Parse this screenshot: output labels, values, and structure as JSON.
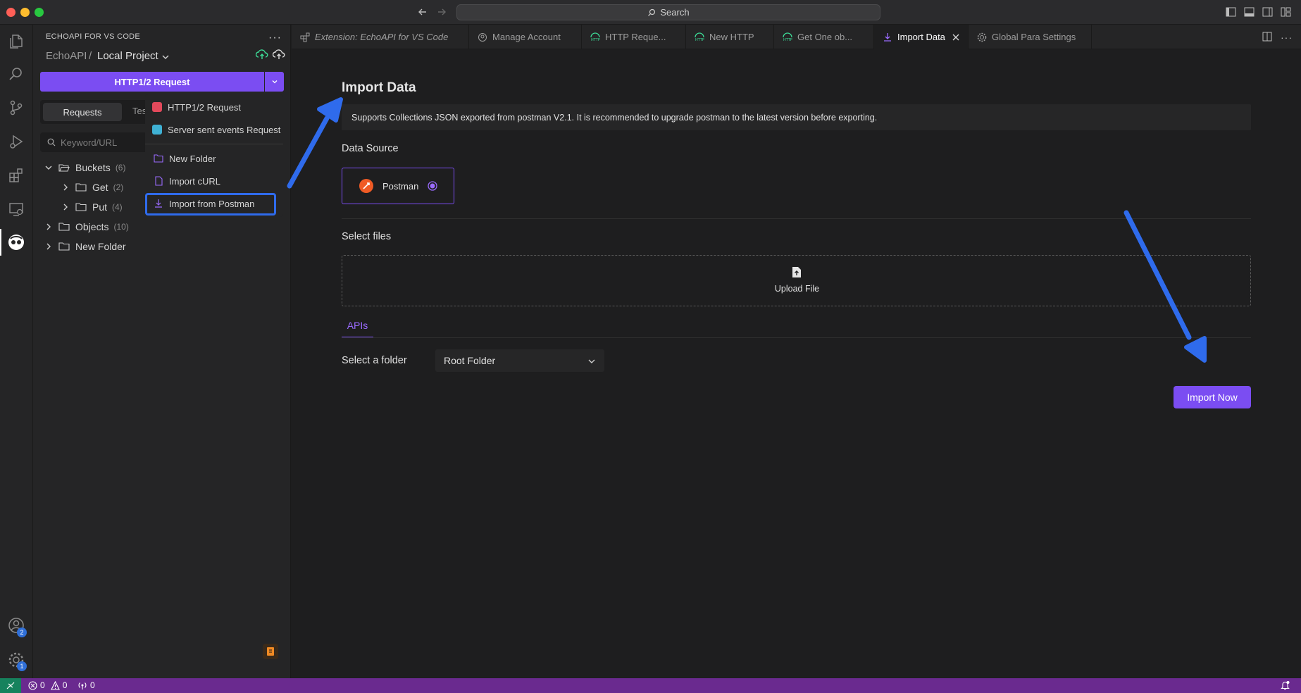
{
  "titlebar": {
    "search": "Search"
  },
  "activity": {
    "account_badge": "2",
    "settings_badge": "1"
  },
  "sidebar": {
    "title": "ECHOAPI FOR VS CODE",
    "crumb_root": "EchoAPI",
    "crumb_sep": "/",
    "crumb_project": "Local Project",
    "http_button": "HTTP1/2 Request",
    "seg_requests": "Requests",
    "seg_tests": "Tes",
    "search_placeholder": "Keyword/URL",
    "tree": [
      {
        "label": "Buckets",
        "count": "(6)"
      },
      {
        "label": "Get",
        "count": "(2)"
      },
      {
        "label": "Put",
        "count": "(4)"
      },
      {
        "label": "Objects",
        "count": "(10)"
      },
      {
        "label": "New Folder",
        "count": ""
      }
    ]
  },
  "dropdown": {
    "items": [
      "HTTP1/2 Request",
      "Server sent events Request",
      "New Folder",
      "Import cURL",
      "Import from Postman"
    ]
  },
  "tabs": [
    {
      "label": "Extension: EchoAPI for VS Code"
    },
    {
      "label": "Manage Account"
    },
    {
      "label": "HTTP Reque..."
    },
    {
      "label": "New HTTP"
    },
    {
      "label": "Get One ob..."
    },
    {
      "label": "Import Data"
    },
    {
      "label": "Global Para Settings"
    }
  ],
  "content": {
    "title": "Import Data",
    "info": "Supports Collections JSON exported from postman V2.1. It is recommended to upgrade postman to the latest version before exporting.",
    "data_source_label": "Data Source",
    "source_option": "Postman",
    "select_files_label": "Select files",
    "upload_label": "Upload File",
    "apis_tab": "APIs",
    "select_folder_label": "Select a folder",
    "folder_value": "Root Folder",
    "import_button": "Import Now"
  },
  "statusbar": {
    "errors": "0",
    "warnings": "0",
    "ports": "0"
  },
  "colors": {
    "accent": "#7b4df2",
    "annotation_blue": "#2f6bec",
    "statusbar": "#6a2a8f"
  }
}
